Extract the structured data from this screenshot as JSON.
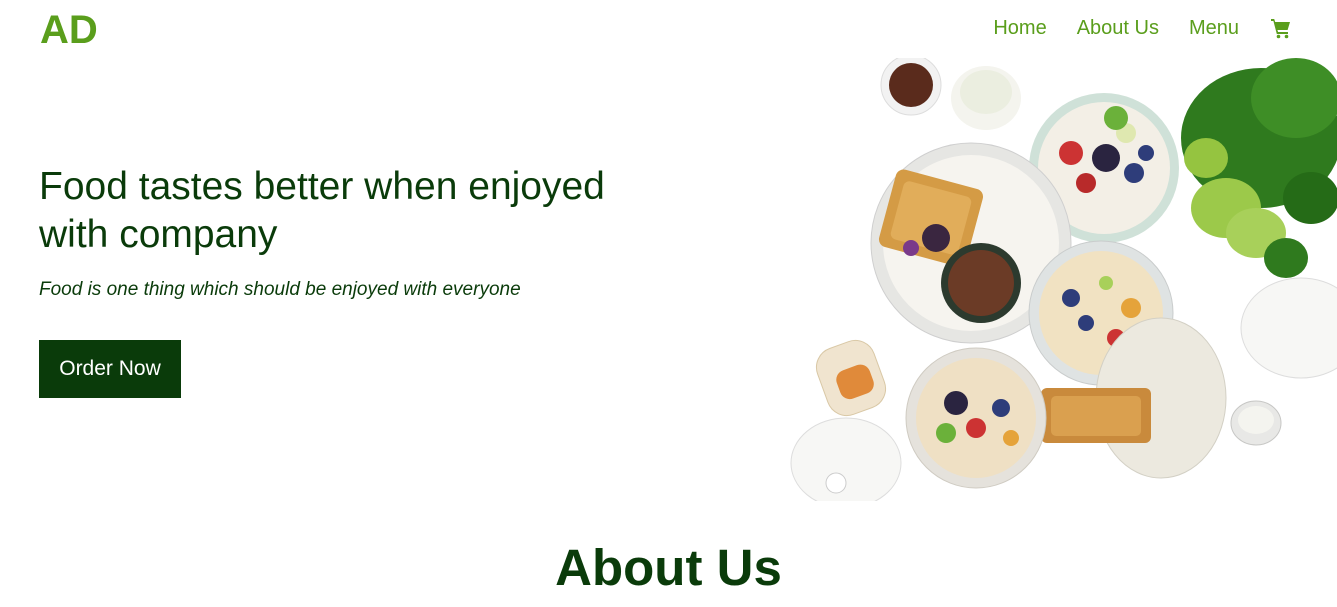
{
  "brand": {
    "logo": "AD"
  },
  "nav": {
    "items": [
      {
        "label": "Home"
      },
      {
        "label": "About Us"
      },
      {
        "label": "Menu"
      }
    ],
    "cart_icon": "shopping-cart-icon"
  },
  "hero": {
    "title": "Food tastes better when enjoyed with company",
    "subtitle": "Food is one thing which should be enjoyed with everyone",
    "cta_label": "Order Now",
    "image": "food-spread-image"
  },
  "about": {
    "heading": "About Us"
  },
  "colors": {
    "accent": "#5a9e1c",
    "dark_green": "#0a3b0a",
    "background": "#ffffff"
  }
}
